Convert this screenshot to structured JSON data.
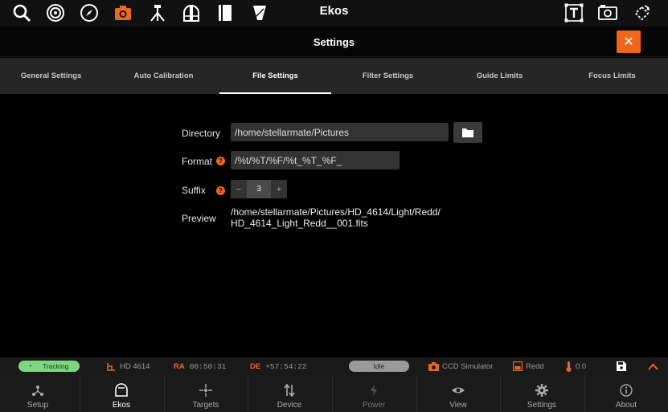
{
  "app": {
    "title": "Ekos"
  },
  "settings": {
    "title": "Settings",
    "close": "✕"
  },
  "tabs": [
    {
      "label": "General Settings"
    },
    {
      "label": "Auto Calibration"
    },
    {
      "label": "File Settings",
      "active": true
    },
    {
      "label": "Filter Settings"
    },
    {
      "label": "Guide Limits"
    },
    {
      "label": "Focus Limits"
    }
  ],
  "form": {
    "directory_label": "Directory",
    "directory_value": "/home/stellarmate/Pictures",
    "format_label": "Format",
    "format_value": "/%t/%T/%F/%t_%T_%F_",
    "suffix_label": "Suffix",
    "suffix_minus": "−",
    "suffix_value": "3",
    "suffix_plus": "+",
    "preview_label": "Preview",
    "preview_line1": "/home/stellarmate/Pictures/HD_4614/Light/Redd/",
    "preview_line2": "HD_4614_Light_Redd__001.fits",
    "help_glyph": "?"
  },
  "status": {
    "tracking": "Tracking",
    "target": "HD 4614",
    "ra_label": "RA",
    "ra_value": "00:50:31",
    "de_label": "DE",
    "de_value": "+57:54:22",
    "state": "Idle",
    "camera": "CCD Simulator",
    "filter": "Redd",
    "temperature": "0.0"
  },
  "nav": [
    {
      "label": "Setup",
      "icon": "setup-icon"
    },
    {
      "label": "Ekos",
      "icon": "ekos-icon",
      "active": true
    },
    {
      "label": "Targets",
      "icon": "targets-icon"
    },
    {
      "label": "Device",
      "icon": "device-icon"
    },
    {
      "label": "Power",
      "icon": "power-icon"
    },
    {
      "label": "View",
      "icon": "view-icon"
    },
    {
      "label": "Settings",
      "icon": "settings-icon"
    },
    {
      "label": "About",
      "icon": "about-icon"
    }
  ],
  "colors": {
    "accent": "#f1661d",
    "tracking_pill": "#7ed67e",
    "idle_pill": "#9a9a9a"
  }
}
